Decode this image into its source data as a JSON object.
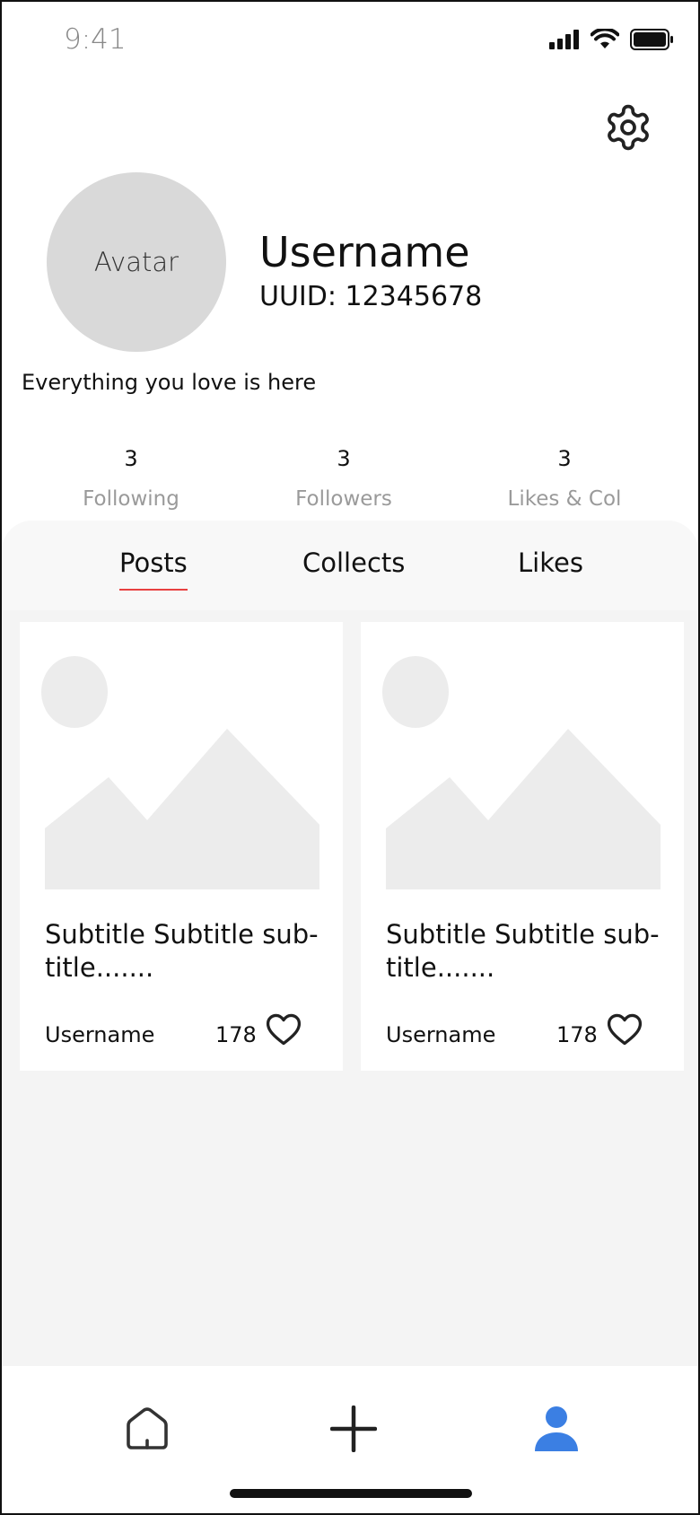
{
  "status_bar": {
    "time": "9:41",
    "icons": [
      "signal-icon",
      "wifi-icon",
      "battery-icon"
    ]
  },
  "header": {
    "settings_icon": "gear-icon"
  },
  "profile": {
    "avatar_label": "Avatar",
    "username": "Username",
    "uuid": "UUID: 12345678",
    "bio": "Everything you love is here"
  },
  "stats": [
    {
      "value": "3",
      "label": "Following"
    },
    {
      "value": "3",
      "label": "Followers"
    },
    {
      "value": "3",
      "label": "Likes & Col"
    }
  ],
  "tabs": [
    {
      "label": "Posts",
      "active": true
    },
    {
      "label": "Collects",
      "active": false
    },
    {
      "label": "Likes",
      "active": false
    }
  ],
  "posts": [
    {
      "title": "Subtitle Subtitle sub-title.......",
      "author": "Username",
      "likes": "178"
    },
    {
      "title": "Subtitle Subtitle sub-title.......",
      "author": "Username",
      "likes": "178"
    }
  ],
  "bottom_nav": [
    {
      "icon": "home-icon",
      "active": false
    },
    {
      "icon": "plus-icon",
      "active": false
    },
    {
      "icon": "user-icon",
      "active": true
    }
  ],
  "colors": {
    "accent_underline": "#e84040",
    "active_nav": "#3b7fe3",
    "placeholder_gray": "#d9d9d9",
    "content_background": "#f4f4f4"
  }
}
